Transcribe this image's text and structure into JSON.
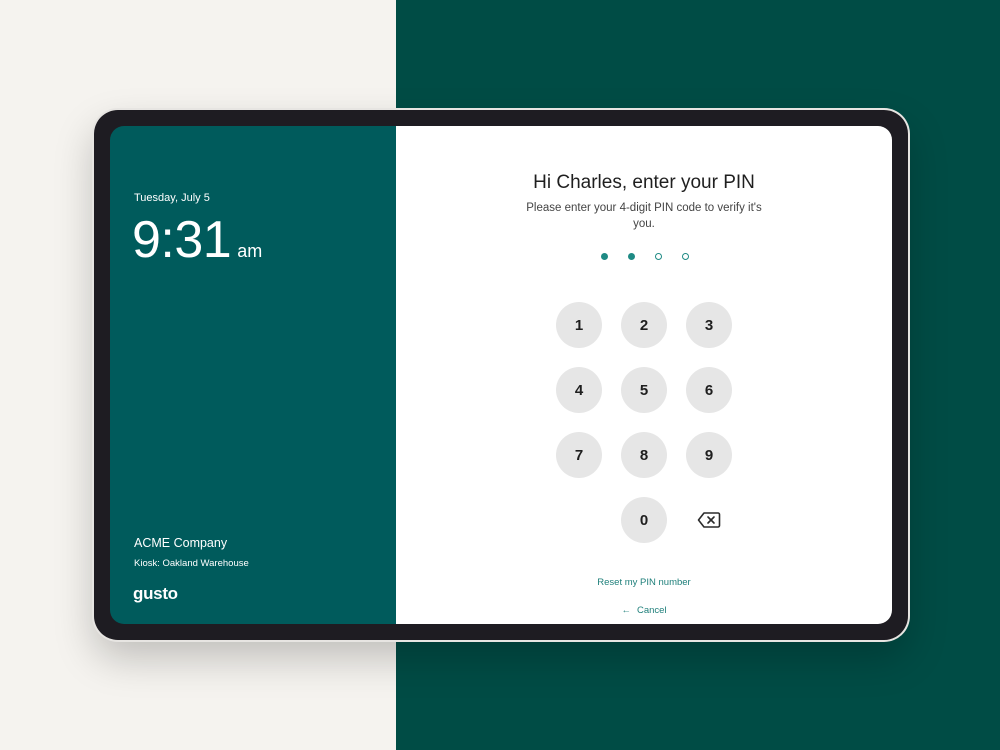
{
  "clock": {
    "date": "Tuesday, July 5",
    "time": "9:31",
    "ampm": "am"
  },
  "company": {
    "name": "ACME Company",
    "kiosk": "Kiosk: Oakland Warehouse",
    "logo": "gusto"
  },
  "pin_prompt": {
    "heading": "Hi Charles, enter your PIN",
    "subheading": "Please enter your 4-digit PIN code to verify it's you.",
    "digits_total": 4,
    "digits_entered": 2
  },
  "keypad": {
    "keys": [
      "1",
      "2",
      "3",
      "4",
      "5",
      "6",
      "7",
      "8",
      "9",
      "0"
    ],
    "backspace_icon": "backspace-icon"
  },
  "links": {
    "reset": "Reset my PIN number",
    "cancel": "Cancel",
    "cancel_icon": "arrow-left-icon"
  },
  "colors": {
    "left_panel": "#005b5c",
    "accent": "#1e8a84",
    "background_dark": "#004c45",
    "background_light": "#f5f3ef"
  }
}
